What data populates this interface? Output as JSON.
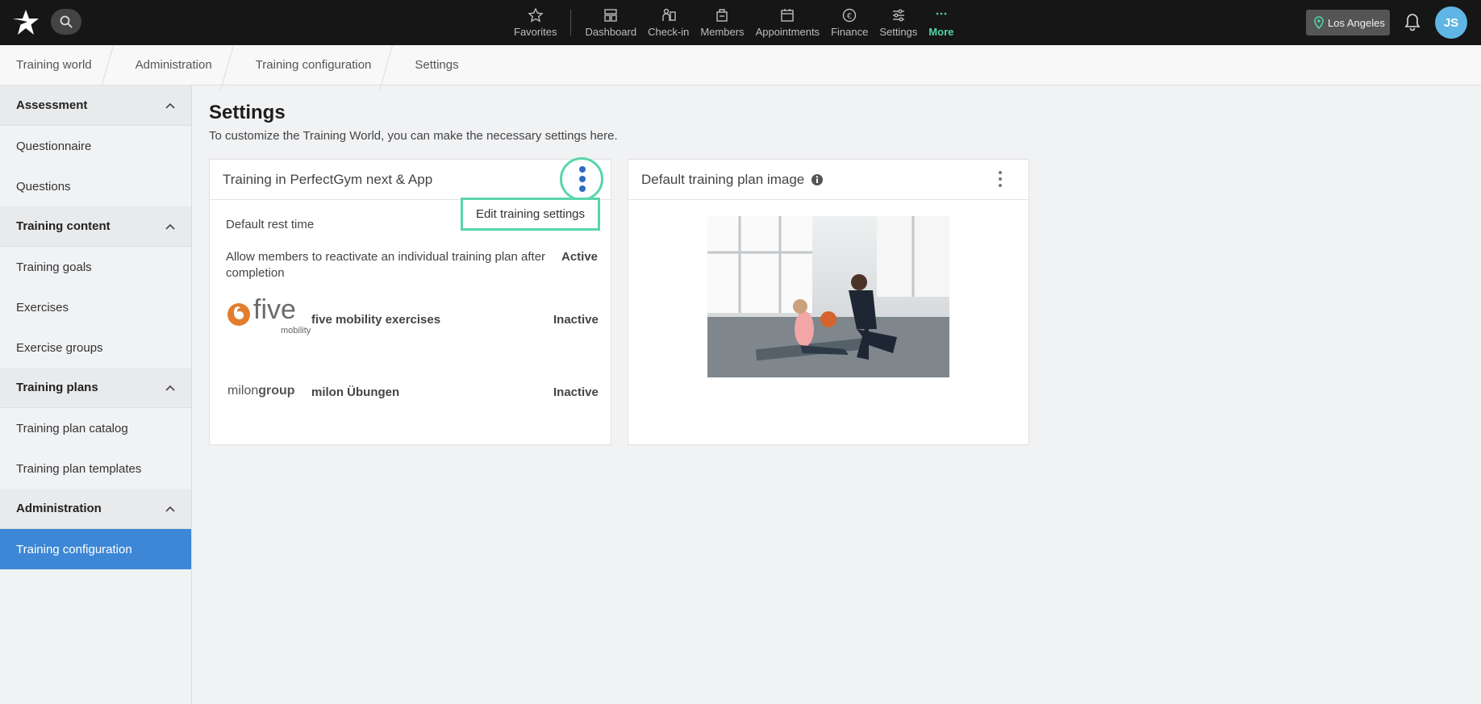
{
  "topbar": {
    "nav": [
      {
        "label": "Favorites",
        "icon": "star-icon"
      },
      {
        "label": "Dashboard",
        "icon": "dashboard-icon"
      },
      {
        "label": "Check-in",
        "icon": "check-in-icon"
      },
      {
        "label": "Members",
        "icon": "members-icon"
      },
      {
        "label": "Appointments",
        "icon": "calendar-icon"
      },
      {
        "label": "Finance",
        "icon": "euro-icon"
      },
      {
        "label": "Settings",
        "icon": "sliders-icon"
      },
      {
        "label": "More",
        "icon": "more-dots-icon"
      }
    ],
    "location": "Los Angeles",
    "avatar_initials": "JS",
    "accent_color": "#4fd6a8"
  },
  "breadcrumb": [
    "Training world",
    "Administration",
    "Training configuration",
    "Settings"
  ],
  "sidebar": {
    "groups": [
      {
        "title": "Assessment",
        "items": [
          "Questionnaire",
          "Questions"
        ]
      },
      {
        "title": "Training content",
        "items": [
          "Training goals",
          "Exercises",
          "Exercise groups"
        ]
      },
      {
        "title": "Training plans",
        "items": [
          "Training plan catalog",
          "Training plan templates"
        ]
      },
      {
        "title": "Administration",
        "items": [
          "Training configuration"
        ]
      }
    ],
    "active_item": "Training configuration",
    "active_color": "#3e87d6"
  },
  "page": {
    "title": "Settings",
    "subtitle": "To customize the Training World, you can make the necessary settings here."
  },
  "training_card": {
    "title": "Training in PerfectGym next & App",
    "menu_item": "Edit training settings",
    "rows": [
      {
        "label": "Default rest time",
        "status": ""
      },
      {
        "label_line1": "Allow members to reactivate an individual training plan after",
        "label_line2": "completion",
        "status": "Active"
      }
    ],
    "integrations": [
      {
        "logo_main": "five",
        "logo_sub": "mobility",
        "label": "five mobility exercises",
        "status": "Inactive"
      },
      {
        "logo_a": "milon",
        "logo_b": "group",
        "label": "milon Übungen",
        "status": "Inactive"
      }
    ]
  },
  "image_card": {
    "title": "Default training plan image"
  }
}
